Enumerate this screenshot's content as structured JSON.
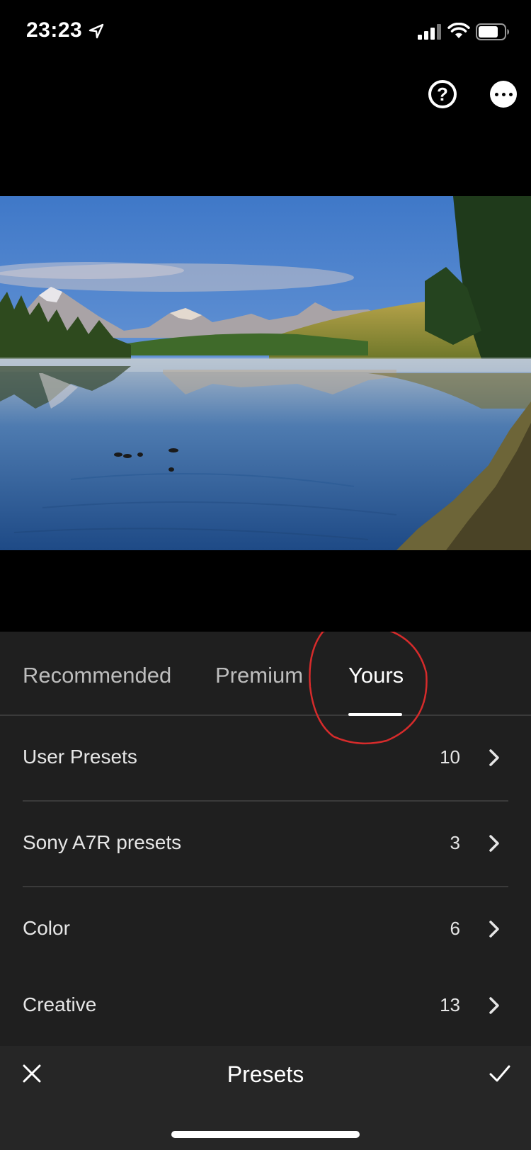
{
  "status_bar": {
    "time": "23:23",
    "icons": [
      "location-arrow-icon",
      "cellular-signal-icon",
      "wifi-icon",
      "battery-icon"
    ]
  },
  "top_actions": {
    "help_icon": "question-circle-icon",
    "help_glyph": "?",
    "more_icon": "more-dots-icon"
  },
  "tabs": [
    {
      "label": "Recommended",
      "active": false
    },
    {
      "label": "Premium",
      "active": false
    },
    {
      "label": "Yours",
      "active": true
    }
  ],
  "annotation": {
    "color": "#d62b2b",
    "target": "Yours"
  },
  "presets": [
    {
      "name": "User Presets",
      "count": "10"
    },
    {
      "name": "Sony A7R presets",
      "count": "3"
    },
    {
      "name": "Color",
      "count": "6"
    },
    {
      "name": "Creative",
      "count": "13"
    }
  ],
  "bottom_bar": {
    "title": "Presets",
    "close_icon": "close-x-icon",
    "confirm_icon": "checkmark-icon"
  },
  "colors": {
    "background": "#000000",
    "panel": "#1f1f1f",
    "bottom_bar": "#262626",
    "divider": "#3a3a3a",
    "text_inactive": "#bdbdbd",
    "text_active": "#ffffff"
  }
}
